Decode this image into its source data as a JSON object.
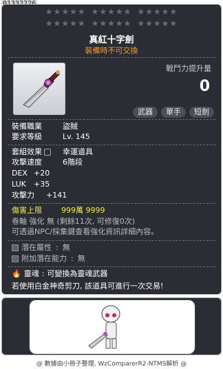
{
  "item_id": "01332226",
  "item": {
    "name": "真紅十字劍",
    "trade_note": "裝備時不可交換",
    "combat_power_label": "戰鬥力提升量",
    "combat_power_value": "0",
    "tags": [
      "武器",
      "單手",
      "短劍"
    ]
  },
  "requirements": {
    "job_label": "裝備職業",
    "job_value": "盜賊",
    "level_label": "要求等級",
    "level_value": "Lv. 145"
  },
  "stats": {
    "set_label": "套組效果",
    "set_value": "幸運道具",
    "speed_label": "攻擊速度",
    "speed_value": "6階段",
    "dex_label": "DEX",
    "dex_value": "+20",
    "luk_label": "LUK",
    "luk_value": "+35",
    "atk_label": "攻擊力",
    "atk_value": "+141",
    "damage_cap_label": "傷害上限",
    "damage_cap_value": "999萬 9999"
  },
  "notes": {
    "upgrade_line": "卷軸 強化 無 (剩餘11次, 可修復0次)",
    "upgrade_line2": "可透過NPC/採集鍵查看強化資訊詳細內容。"
  },
  "potential": {
    "potential_label": "潛在屬性",
    "potential_value": "無",
    "additional_label": "附加潛在能力",
    "additional_value": "無"
  },
  "soul": {
    "label": "靈魂",
    "value": "可變換為靈魂武器",
    "trade_hint": "若使用白金神奇剪刀, 該道具可進行一次交易!"
  },
  "footer": "@ 數據由小冊子整理, WzComparerR2-NTMS解析 @",
  "colors": {
    "background": "#2a2d33",
    "trade_orange": "#ff9a1e",
    "damage_yellow": "#f2ea3c"
  }
}
